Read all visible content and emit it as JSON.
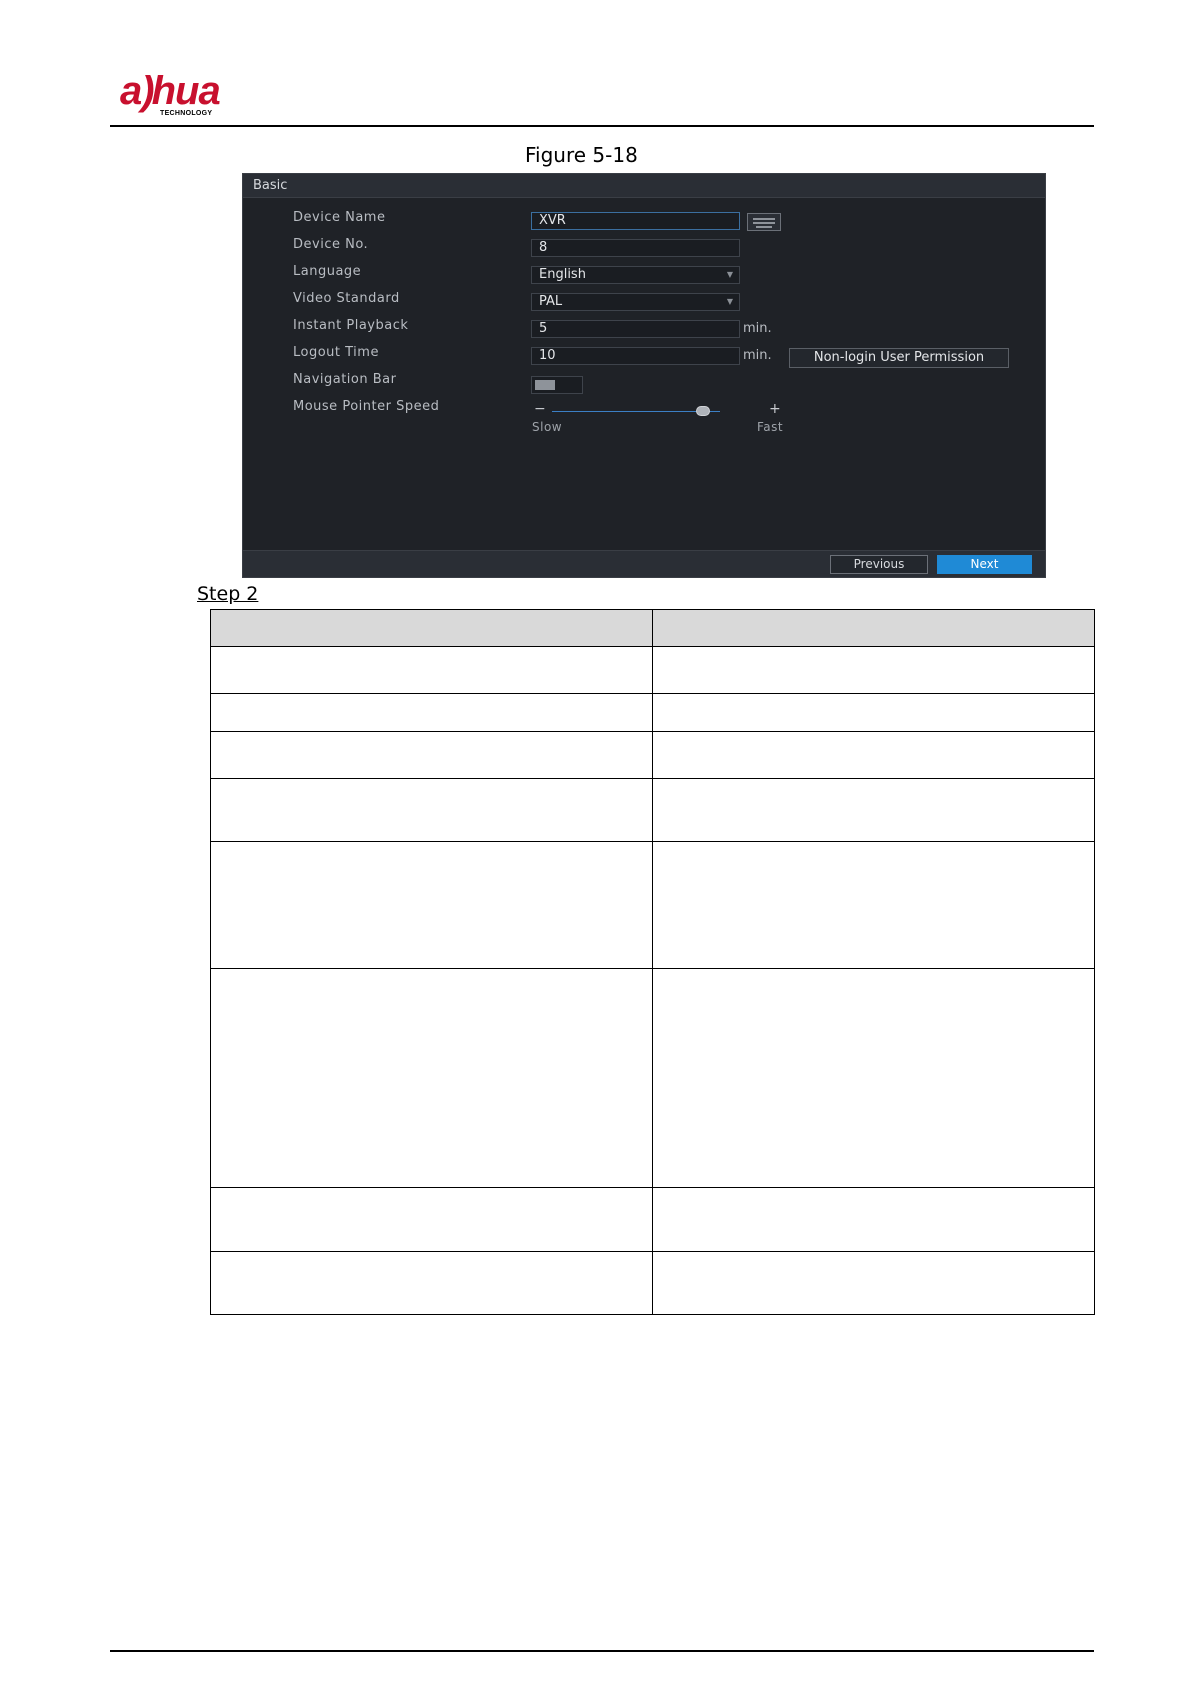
{
  "header": {
    "logo_text": "alhua",
    "logo_tagline": "TECHNOLOGY"
  },
  "figure": {
    "caption": "Figure 5-18"
  },
  "basic_panel": {
    "title": "Basic",
    "fields": {
      "device_name": {
        "label": "Device Name",
        "value": "XVR"
      },
      "device_no": {
        "label": "Device No.",
        "value": "8"
      },
      "language": {
        "label": "Language",
        "value": "English"
      },
      "video_standard": {
        "label": "Video Standard",
        "value": "PAL"
      },
      "instant_playback": {
        "label": "Instant Playback",
        "value": "5",
        "unit": "min."
      },
      "logout_time": {
        "label": "Logout Time",
        "value": "10",
        "unit": "min."
      },
      "navigation_bar": {
        "label": "Navigation Bar",
        "enabled": false
      },
      "mouse_pointer_speed": {
        "label": "Mouse Pointer Speed",
        "minus": "−",
        "plus": "+",
        "min_label": "Slow",
        "max_label": "Fast",
        "level": 0.9
      }
    },
    "non_login_button": "Non-login User Permission",
    "previous_button": "Previous",
    "next_button": "Next",
    "icons": {
      "keyboard": "keyboard-icon",
      "dropdown": "chevron-down-icon"
    },
    "colors": {
      "panel_bg": "#1f2227",
      "accent": "#1f8ad6"
    }
  },
  "step": {
    "label": "Step 2"
  }
}
